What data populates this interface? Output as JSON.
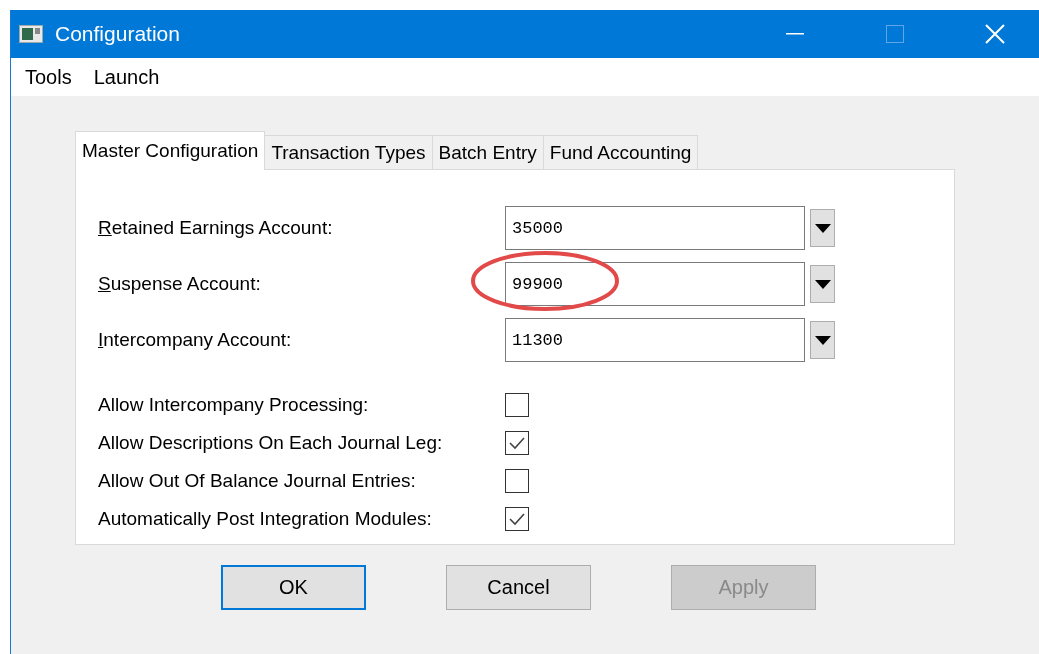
{
  "window": {
    "title": "Configuration"
  },
  "menu": [
    "Tools",
    "Launch"
  ],
  "tabs": [
    {
      "label": "Master Configuration",
      "selected": true
    },
    {
      "label": "Transaction Types",
      "selected": false
    },
    {
      "label": "Batch Entry",
      "selected": false
    },
    {
      "label": "Fund Accounting",
      "selected": false
    }
  ],
  "account_fields": [
    {
      "label": "Retained Earnings Account:",
      "mnemonic": true,
      "value": "35000",
      "highlighted": false
    },
    {
      "label": "Suspense Account:",
      "mnemonic": true,
      "value": "99900",
      "highlighted": true
    },
    {
      "label": "Intercompany Account:",
      "mnemonic": true,
      "value": "11300",
      "highlighted": false
    }
  ],
  "options": [
    {
      "label": "Allow Intercompany Processing:",
      "checked": false
    },
    {
      "label": "Allow Descriptions On Each Journal Leg:",
      "checked": true
    },
    {
      "label": "Allow Out Of Balance Journal Entries:",
      "checked": false
    },
    {
      "label": "Automatically Post Integration Modules:",
      "checked": true
    }
  ],
  "buttons": [
    {
      "label": "OK",
      "default": true,
      "disabled": false
    },
    {
      "label": "Cancel",
      "default": false,
      "disabled": false
    },
    {
      "label": "Apply",
      "default": false,
      "disabled": true
    }
  ]
}
